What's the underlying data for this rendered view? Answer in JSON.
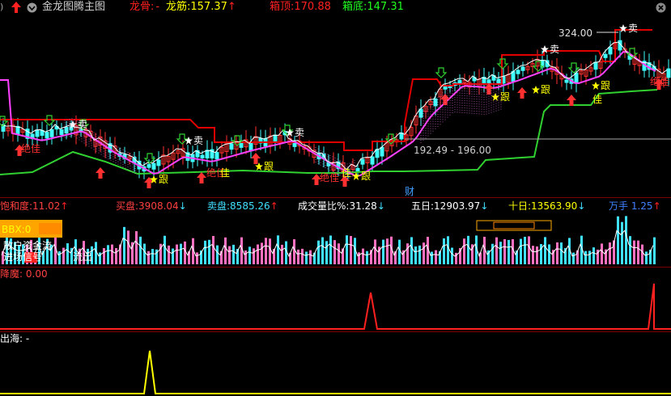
{
  "header": {
    "title": "金龙图腾主图",
    "items": [
      {
        "label": "龙骨:",
        "value": "-",
        "arrow": "",
        "label_color": "#ff2020",
        "value_color": "#ff2020"
      },
      {
        "label": "龙筋:",
        "value": "157.37",
        "arrow": "↑",
        "label_color": "#ffff00",
        "value_color": "#ffff00"
      },
      {
        "label": "箱顶:",
        "value": "170.88",
        "arrow": "",
        "label_color": "#ff2020",
        "value_color": "#ff2020"
      },
      {
        "label": "箱底:",
        "value": "147.31",
        "arrow": "",
        "label_color": "#20ff20",
        "value_color": "#20ff20"
      }
    ]
  },
  "main_chart": {
    "price_label_high": "324.00",
    "box_label": "192.49 - 196.00",
    "marker_sell": "卖",
    "marker_follow": "跟",
    "marker_great": "绝佳",
    "marker_live": "佳",
    "marker_cai": "财",
    "edge_char": "卖"
  },
  "volume_header": {
    "items": [
      {
        "label": "饱和度:",
        "value": "11.02",
        "arrow": "↑",
        "color": "#ff4040"
      },
      {
        "label": "买盘:",
        "value": "3908.04",
        "arrow": "↓",
        "color": "#ff4040"
      },
      {
        "label": "卖盘:",
        "value": "8585.26",
        "arrow": "↑",
        "color": "#40e0ff"
      },
      {
        "label": "成交量比%:",
        "value": "31.28",
        "arrow": "↓",
        "color": "#ffffff"
      },
      {
        "label": "五日:",
        "value": "12903.97",
        "arrow": "↓",
        "color": "#ffffff"
      },
      {
        "label": "十日:",
        "value": "13563.90",
        "arrow": "↓",
        "color": "#ffff00"
      },
      {
        "label": "万手",
        "value": "1.25",
        "arrow": "↑",
        "color": "#4080ff"
      }
    ],
    "bbx_label": "BBX:0",
    "left_text_1": "散户资金流",
    "left_text_2": "进场信号",
    "left_text_3": "流出"
  },
  "indicator_pane_1": {
    "label": "降魔:",
    "value": "0.00"
  },
  "indicator_pane_2": {
    "label": "出海:",
    "value": "-"
  },
  "chart_data": {
    "type": "candlestick",
    "price_high_marked": 324.0,
    "box_range": [
      192.49,
      196.0
    ],
    "series": [
      {
        "name": "龙筋",
        "last": 157.37
      },
      {
        "name": "箱顶",
        "last": 170.88
      },
      {
        "name": "箱底",
        "last": 147.31
      }
    ],
    "volume": {
      "buy": 3908.04,
      "sell": 8585.26,
      "ratio_pct": 31.28,
      "ma5": 12903.97,
      "ma10": 13563.9,
      "unit_value": 1.25
    }
  },
  "colors": {
    "up": "#ff3030",
    "down": "#40ffff",
    "pink": "#ff70c0",
    "magenta": "#ff40ff",
    "green": "#30d030",
    "red": "#e00000",
    "yellow": "#ffff00"
  }
}
